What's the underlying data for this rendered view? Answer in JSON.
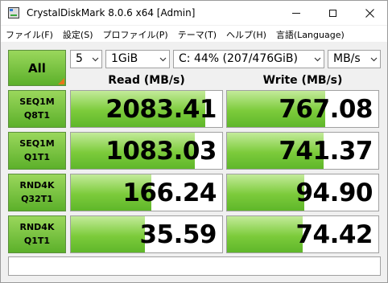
{
  "window": {
    "title": "CrystalDiskMark 8.0.6 x64 [Admin]"
  },
  "menu": [
    "ファイル(F)",
    "設定(S)",
    "プロファイル(P)",
    "テーマ(T)",
    "ヘルプ(H)",
    "言語(Language)"
  ],
  "controls": {
    "all_label": "All",
    "count": "5",
    "size": "1GiB",
    "drive": "C: 44% (207/476GiB)",
    "unit": "MB/s"
  },
  "headers": {
    "read": "Read (MB/s)",
    "write": "Write (MB/s)"
  },
  "rows": [
    {
      "test": "SEQ1M",
      "queue": "Q8T1",
      "read": "2083.41",
      "write": "767.08",
      "read_fill": 0.89,
      "write_fill": 0.65
    },
    {
      "test": "SEQ1M",
      "queue": "Q1T1",
      "read": "1083.03",
      "write": "741.37",
      "read_fill": 0.82,
      "write_fill": 0.64
    },
    {
      "test": "RND4K",
      "queue": "Q32T1",
      "read": "166.24",
      "write": "94.90",
      "read_fill": 0.53,
      "write_fill": 0.51
    },
    {
      "test": "RND4K",
      "queue": "Q1T1",
      "read": "35.59",
      "write": "74.42",
      "read_fill": 0.49,
      "write_fill": 0.5
    }
  ],
  "comment": "",
  "colors": {
    "green_top": "#9ad75c",
    "green_bottom": "#5cb02a",
    "corner": "#e8751a"
  }
}
